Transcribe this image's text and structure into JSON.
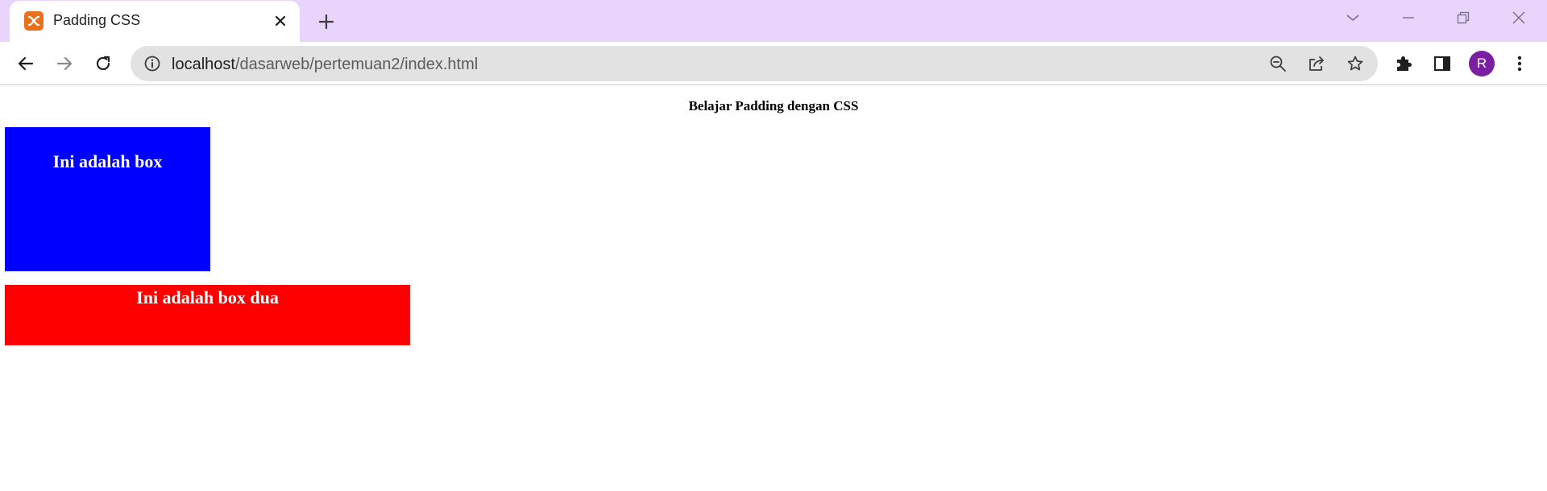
{
  "browser": {
    "tab": {
      "title": "Padding CSS",
      "favicon": "xampp-icon"
    },
    "address_bar": {
      "host": "localhost",
      "path": "/dasarweb/pertemuan2/index.html"
    },
    "profile_initial": "R",
    "colors": {
      "tabstrip": "#e9d5fb",
      "avatar": "#7b1fa2",
      "favicon": "#e8711e"
    }
  },
  "page": {
    "heading": "Belajar Padding dengan CSS",
    "box_one": {
      "text": "Ini adalah box",
      "color": "#0000ff"
    },
    "box_two": {
      "text": "Ini adalah box dua",
      "color": "#ff0000"
    }
  }
}
